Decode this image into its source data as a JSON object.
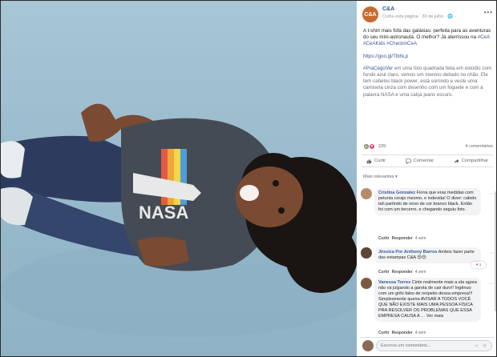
{
  "window": {
    "title": "C&A"
  },
  "post": {
    "page_name": "C&A",
    "page_avatar_text": "C&A",
    "meta": "Curtiu esta página · 30 de julho · 🌐",
    "more_icon": "more-dots-icon",
    "text_p1": "A t-shirt mais fofa das galáxias: perfeita para as aventuras do seu mini-astronauta. O melhor? Já aterrissou na ",
    "text_p1_tags": "#CeA #CeAKids #CheckinCeA",
    "link": "https://goo.gl/TlbhLp",
    "text_p3_tag": "#PraCegoVer",
    "text_p3": " em uma foto quadrada feita em estúdio com fundo azul claro, vemos um menino deitado no chão. Ele tem cabelos black power, está sorrindo e veste uma camiseta cinza com desenho com um foguete e com a palavra NASA e uma calça jeans escuro.",
    "reaction_count": "239",
    "comments_count": "4 comentários"
  },
  "actions": {
    "like_label": "Curtir",
    "comment_label": "Comentar",
    "share_label": "Compartilhar"
  },
  "more_relevant": "Mais relevantes ▾",
  "comments": [
    {
      "name": "Cristina Gonzalez",
      "text": " Fiona que eras medidas com petunia corajo mesmo, e indevida! O dizer: cabelo tah partindo de novo de cor branco black. Então foi com um tercerro, e chegando seguiu foto.",
      "reply_label": "Curtir",
      "respond_label": "Responder",
      "time": "4 sem"
    },
    {
      "name": "Jéssica Por Anthony Barros",
      "text": " Ambos fazer parte das estampas C&A 😍😍",
      "reply_label": "Curtir",
      "respond_label": "Responder",
      "time": "4 sem",
      "reaction": "1"
    },
    {
      "name": "Vanessa Torres",
      "text": " Cinte realmente mais a ela agora não vá julgando a garota de cair duro!! Ingênuo com um grifo falso de respeito dessa empresa!!! Simplesmente queira AVISAR A TODOS VOCÊ QUE NÃO EXISTE MAIS UMA PESSOA FÍSICA PRA RESOLVER OS PROBLEMAS QUE ESSA EMPRESA CAUSA A … Ver mais",
      "reply_label": "Curtir",
      "respond_label": "Responder",
      "time": "4 sem"
    }
  ],
  "comment_box": {
    "placeholder": "Escreva um comentário..."
  },
  "photo": {
    "shirt_text": "NASA",
    "description_icon": "photo-boy-nasa-shirt"
  },
  "colors": {
    "link": "#385898",
    "like": "#1877f2",
    "love": "#e94560",
    "photo_bg": "#a7c6d6"
  }
}
